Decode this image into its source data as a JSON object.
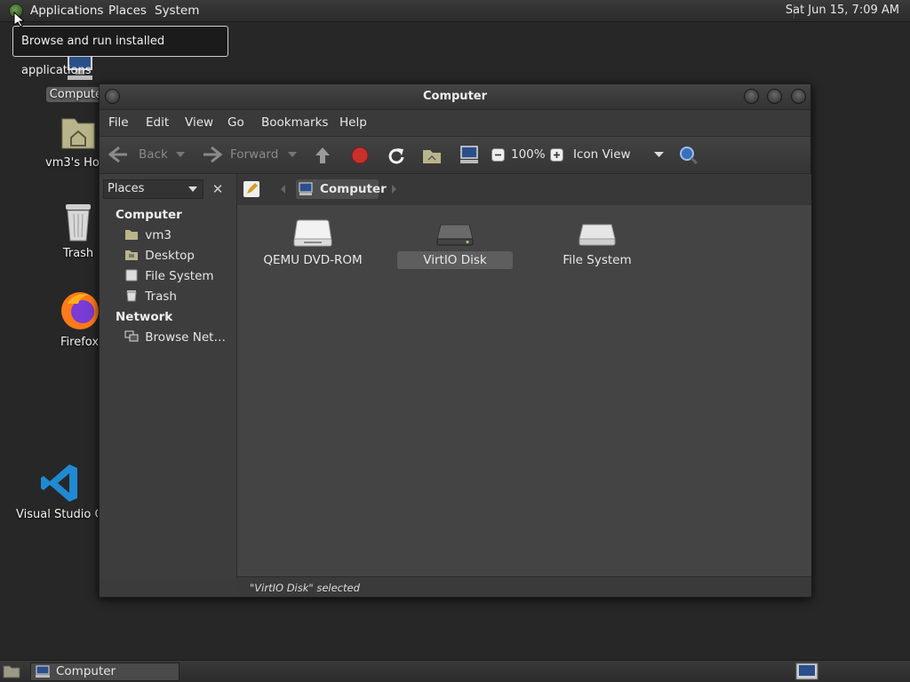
{
  "top_panel": {
    "menus": [
      "Applications",
      "Places",
      "System"
    ],
    "clock": "Sat Jun 15,  7:09 AM"
  },
  "tooltip": "Browse and run installed applications",
  "desktop_icons": [
    {
      "label": "Computer",
      "icon": "computer-icon"
    },
    {
      "label": "vm3's Home",
      "icon": "home-folder-icon"
    },
    {
      "label": "Trash",
      "icon": "trash-icon"
    },
    {
      "label": "Firefox",
      "icon": "firefox-icon"
    },
    {
      "label": "Visual Studio Code",
      "icon": "vscode-icon"
    }
  ],
  "window": {
    "title": "Computer",
    "menubar": [
      "File",
      "Edit",
      "View",
      "Go",
      "Bookmarks",
      "Help"
    ],
    "toolbar": {
      "back": "Back",
      "forward": "Forward",
      "zoom": "100%",
      "view_mode": "Icon View"
    },
    "location": {
      "current": "Computer"
    },
    "sidebar": {
      "selector": "Places",
      "sections": [
        {
          "title": "Computer",
          "items": [
            "vm3",
            "Desktop",
            "File System",
            "Trash"
          ]
        },
        {
          "title": "Network",
          "items": [
            "Browse Net…"
          ]
        }
      ]
    },
    "items": [
      {
        "label": "QEMU DVD-ROM",
        "icon": "optical-drive-icon",
        "selected": false
      },
      {
        "label": "VirtIO Disk",
        "icon": "hard-disk-icon",
        "selected": true
      },
      {
        "label": "File System",
        "icon": "filesystem-drive-icon",
        "selected": false
      }
    ],
    "status": "\"VirtIO Disk\" selected"
  },
  "bottom_panel": {
    "task_label": "Computer"
  },
  "colors": {
    "panel": "#2e2e2e",
    "window_bg": "#3b3b3b",
    "content_bg": "#444444",
    "stop_red": "#c9302c"
  }
}
